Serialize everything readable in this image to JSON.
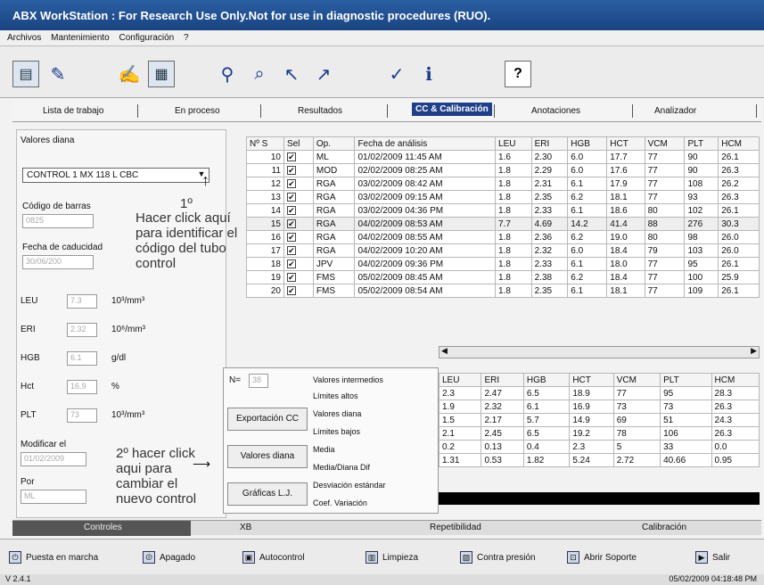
{
  "window": {
    "title": "ABX WorkStation : For Research Use Only.Not for use in diagnostic procedures (RUO)."
  },
  "menu": [
    "Archivos",
    "Mantenimiento",
    "Configuración",
    "?"
  ],
  "toolbar": {
    "help_label": "?"
  },
  "tabs": [
    "Lista de trabajo",
    "En proceso",
    "Resultados",
    "CC & Calibración",
    "Anotaciones",
    "Analizador"
  ],
  "left": {
    "section_title": "Valores diana",
    "control_select": "CONTROL 1   MX 118 L   CBC",
    "barcode_label": "Código de barras",
    "barcode_value": "0825",
    "expiry_label": "Fecha de caducidad",
    "expiry_value": "30/06/200",
    "params": [
      {
        "name": "LEU",
        "value": "7.3",
        "unit": "10³/mm³"
      },
      {
        "name": "ERI",
        "value": "2.32",
        "unit": "10⁶/mm³"
      },
      {
        "name": "HGB",
        "value": "6.1",
        "unit": "g/dl"
      },
      {
        "name": "Hct",
        "value": "16.9",
        "unit": "%"
      },
      {
        "name": "PLT",
        "value": "73",
        "unit": "10³/mm³"
      }
    ],
    "modified_label": "Modificar el",
    "modified_value": "01/02/2009",
    "by_label": "Por",
    "by_value": "ML"
  },
  "annotations": {
    "step1_number": "1º",
    "step1_lines": [
      "Hacer click aquí",
      "para identificar el",
      "código del tubo",
      "control"
    ],
    "step2_lines": [
      "2º hacer click",
      "aqui para",
      "cambiar el",
      "nuevo control"
    ]
  },
  "results_table": {
    "headers": [
      "Nº S",
      "Sel",
      "Op.",
      "Fecha de análisis",
      "LEU",
      "ERI",
      "HGB",
      "HCT",
      "VCM",
      "PLT",
      "HCM"
    ],
    "rows": [
      [
        "10",
        "✔",
        "ML",
        "01/02/2009 11:45 AM",
        "1.6",
        "2.30",
        "6.0",
        "17.7",
        "77",
        "90",
        "26.1"
      ],
      [
        "11",
        "✔",
        "MOD",
        "02/02/2009 08:25 AM",
        "1.8",
        "2.29",
        "6.0",
        "17.6",
        "77",
        "90",
        "26.3"
      ],
      [
        "12",
        "✔",
        "RGA",
        "03/02/2009 08:42 AM",
        "1.8",
        "2.31",
        "6.1",
        "17.9",
        "77",
        "108",
        "26.2"
      ],
      [
        "13",
        "✔",
        "RGA",
        "03/02/2009 09:15 AM",
        "1.8",
        "2.35",
        "6.2",
        "18.1",
        "77",
        "93",
        "26.3"
      ],
      [
        "14",
        "✔",
        "RGA",
        "03/02/2009 04:36 PM",
        "1.8",
        "2.33",
        "6.1",
        "18.6",
        "80",
        "102",
        "26.1"
      ],
      [
        "15",
        "✔",
        "RGA",
        "04/02/2009 08:53 AM",
        "7.7",
        "4.69",
        "14.2",
        "41.4",
        "88",
        "276",
        "30.3"
      ],
      [
        "16",
        "✔",
        "RGA",
        "04/02/2009 08:55 AM",
        "1.8",
        "2.36",
        "6.2",
        "19.0",
        "80",
        "98",
        "26.0"
      ],
      [
        "17",
        "✔",
        "RGA",
        "04/02/2009 10:20 AM",
        "1.8",
        "2.32",
        "6.0",
        "18.4",
        "79",
        "103",
        "26.0"
      ],
      [
        "18",
        "✔",
        "JPV",
        "04/02/2009 09:36 PM",
        "1.8",
        "2.33",
        "6.1",
        "18.0",
        "77",
        "95",
        "26.1"
      ],
      [
        "19",
        "✔",
        "FMS",
        "05/02/2009 08:45 AM",
        "1.8",
        "2.38",
        "6.2",
        "18.4",
        "77",
        "100",
        "25.9"
      ],
      [
        "20",
        "✔",
        "FMS",
        "05/02/2009 08:54 AM",
        "1.8",
        "2.35",
        "6.1",
        "18.1",
        "77",
        "109",
        "26.1"
      ]
    ]
  },
  "stats": {
    "n_label": "N=",
    "n_value": "38",
    "export_button": "Exportación CC",
    "target_button": "Valores diana",
    "charts_button": "Gráficas L.J.",
    "labels": [
      "Valores intermedios",
      "Límites altos",
      "Valores diana",
      "Límites bajos",
      "Media",
      "Media/Diana Dif",
      "Desviación estándar",
      "Coef. Variación"
    ]
  },
  "stats_table": {
    "headers": [
      "LEU",
      "ERI",
      "HGB",
      "HCT",
      "VCM",
      "PLT",
      "HCM"
    ],
    "rows": [
      [
        "2.3",
        "2.47",
        "6.5",
        "18.9",
        "77",
        "95",
        "28.3"
      ],
      [
        "1.9",
        "2.32",
        "6.1",
        "16.9",
        "73",
        "73",
        "26.3"
      ],
      [
        "1.5",
        "2.17",
        "5.7",
        "14.9",
        "69",
        "51",
        "24.3"
      ],
      [
        "2.1",
        "2.45",
        "6.5",
        "19.2",
        "78",
        "106",
        "26.3"
      ],
      [
        "0.2",
        "0.13",
        "0.4",
        "2.3",
        "5",
        "33",
        "0.0"
      ],
      [
        "1.31",
        "0.53",
        "1.82",
        "5.24",
        "2.72",
        "40.66",
        "0.95"
      ]
    ]
  },
  "bottom_tabs": [
    "Controles",
    "XB",
    "Repetibilidad",
    "Calibración"
  ],
  "bottom_buttons": [
    "Puesta en marcha",
    "Apagado",
    "Autocontrol",
    "Limpieza",
    "Contra presión",
    "Abrir Soporte",
    "Salir"
  ],
  "status": {
    "version": "V 2.4.1",
    "datetime": "05/02/2009 04:18:48 PM"
  }
}
